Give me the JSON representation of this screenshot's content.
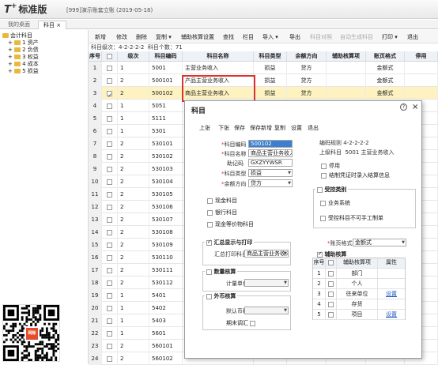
{
  "app": {
    "logo": "T",
    "logo_plus": "+",
    "edition": "标准版",
    "account": "[999]演示账套立账 (2019-05-18)"
  },
  "tabs": [
    "我的桌面",
    "科目"
  ],
  "tree": {
    "root": "会计科目",
    "items": [
      "1 资产",
      "2 负债",
      "3 权益",
      "4 成本",
      "5 损益"
    ]
  },
  "toolbar": [
    "新增",
    "修改",
    "删除",
    "复制",
    "辅助核算设置",
    "查找",
    "栏目",
    "导入",
    "导出",
    "科目对照",
    "自动生成科目",
    "打印",
    "退出"
  ],
  "info": {
    "level_label": "科目级次：",
    "level_value": "4-2-2-2-2",
    "count_label": "科目个数：",
    "count_value": "71"
  },
  "grid": {
    "headers": [
      "序号",
      "",
      "级次",
      "科目编码",
      "科目名称",
      "科目类型",
      "余额方向",
      "辅助核算项",
      "账页格式",
      "停用"
    ],
    "rows": [
      [
        "1",
        "",
        "1",
        "5001",
        "主营业务收入",
        "损益",
        "贷方",
        "",
        "金额式",
        ""
      ],
      [
        "2",
        "",
        "2",
        "500101",
        "产品主营业务收入",
        "损益",
        "贷方",
        "",
        "金额式",
        ""
      ],
      [
        "3",
        "✓",
        "2",
        "500102",
        "商品主营业务收入",
        "损益",
        "贷方",
        "",
        "金额式",
        ""
      ],
      [
        "4",
        "",
        "1",
        "5051",
        "",
        "",
        "",
        "",
        "",
        ""
      ],
      [
        "5",
        "",
        "1",
        "5111",
        "",
        "",
        "",
        "",
        "",
        ""
      ],
      [
        "6",
        "",
        "1",
        "5301",
        "",
        "",
        "",
        "",
        "",
        ""
      ],
      [
        "7",
        "",
        "2",
        "530101",
        "",
        "",
        "",
        "",
        "",
        ""
      ],
      [
        "8",
        "",
        "2",
        "530102",
        "",
        "",
        "",
        "",
        "",
        ""
      ],
      [
        "9",
        "",
        "2",
        "530103",
        "",
        "",
        "",
        "",
        "",
        ""
      ],
      [
        "10",
        "",
        "2",
        "530104",
        "",
        "",
        "",
        "",
        "",
        ""
      ],
      [
        "11",
        "",
        "2",
        "530105",
        "",
        "",
        "",
        "",
        "",
        ""
      ],
      [
        "12",
        "",
        "2",
        "530106",
        "",
        "",
        "",
        "",
        "",
        ""
      ],
      [
        "13",
        "",
        "2",
        "530107",
        "",
        "",
        "",
        "",
        "",
        ""
      ],
      [
        "14",
        "",
        "2",
        "530108",
        "",
        "",
        "",
        "",
        "",
        ""
      ],
      [
        "15",
        "",
        "2",
        "530109",
        "",
        "",
        "",
        "",
        "",
        ""
      ],
      [
        "16",
        "",
        "2",
        "530110",
        "",
        "",
        "",
        "",
        "",
        ""
      ],
      [
        "17",
        "",
        "2",
        "530111",
        "",
        "",
        "",
        "",
        "",
        ""
      ],
      [
        "18",
        "",
        "2",
        "530112",
        "",
        "",
        "",
        "",
        "",
        ""
      ],
      [
        "19",
        "",
        "1",
        "5401",
        "",
        "",
        "",
        "",
        "",
        ""
      ],
      [
        "20",
        "",
        "1",
        "5402",
        "",
        "",
        "",
        "",
        "",
        ""
      ],
      [
        "21",
        "",
        "1",
        "5403",
        "",
        "",
        "",
        "",
        "",
        ""
      ],
      [
        "22",
        "",
        "1",
        "5601",
        "",
        "",
        "",
        "",
        "",
        ""
      ],
      [
        "23",
        "",
        "2",
        "560101",
        "",
        "",
        "",
        "",
        "",
        ""
      ],
      [
        "24",
        "",
        "2",
        "560102",
        "",
        "",
        "",
        "",
        "",
        ""
      ]
    ]
  },
  "dialog": {
    "title": "科目",
    "toolbar": [
      "上张",
      "下张",
      "保存",
      "保存新增",
      "复制",
      "设置",
      "退出"
    ],
    "code_label": "科目编码",
    "code_value": "500102",
    "name_label": "科目名称",
    "name_value": "商品主营业务收入",
    "mnemonic_label": "助记码",
    "mnemonic_value": "GXZYYWSR",
    "type_label": "科目类型",
    "type_value": "损益",
    "direction_label": "余额方向",
    "direction_value": "贷方",
    "checks_left": [
      "现金科目",
      "银行科目",
      "现金等价物科目"
    ],
    "rule_label": "编码规则",
    "rule_value": "4-2-2-2-2",
    "parent_label": "上级科目",
    "parent_value": "5001 主营业务收入",
    "checks_right": [
      "停用",
      "结制凭证时录入结算信息"
    ],
    "controlled_title": "受控类别",
    "controlled_checks": [
      "业务系统",
      "受控科目不可手工制单"
    ],
    "summary_title": "汇总显示与打印",
    "summary_label": "汇总打印科目",
    "summary_value": "商品主营业务收入",
    "qty_title": "数量核算",
    "unit_label": "计量单位",
    "fx_title": "外币核算",
    "currency_label": "默认币种",
    "fx_check": "期末调汇",
    "format_label": "账页格式",
    "format_value": "金额式",
    "aux_title": "辅助核算",
    "aux_headers": [
      "序号",
      "",
      "辅助核算项",
      "属性"
    ],
    "aux_rows": [
      [
        "1",
        "部门",
        ""
      ],
      [
        "2",
        "个人",
        ""
      ],
      [
        "3",
        "往来单位",
        "设置"
      ],
      [
        "4",
        "存货",
        ""
      ],
      [
        "5",
        "项目",
        "设置"
      ]
    ]
  },
  "qr_badge": "网账"
}
